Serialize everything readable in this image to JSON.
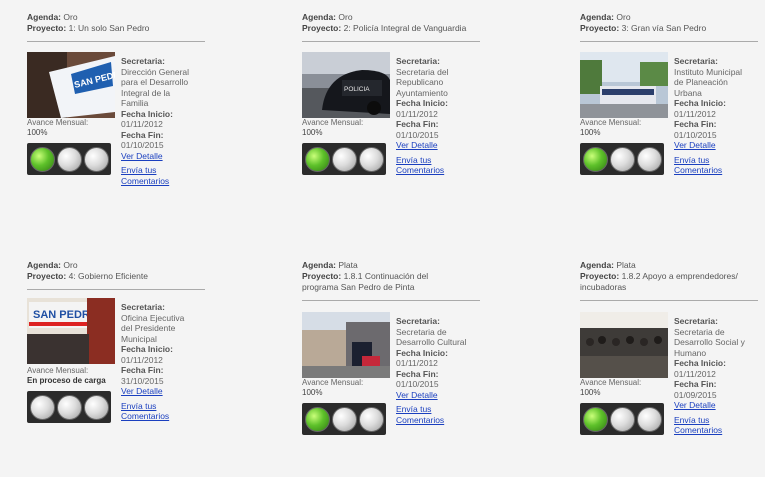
{
  "labels": {
    "agenda": "Agenda:",
    "proyecto": "Proyecto:",
    "secretaria": "Secretaria:",
    "fecha_inicio": "Fecha Inicio:",
    "fecha_fin": "Fecha Fin:",
    "avance": "Avance Mensual:",
    "ver_detalle": "Ver Detalle",
    "envia_1": "Envía tus",
    "envia_2": "Comentarios"
  },
  "cards": [
    {
      "agenda": "Oro",
      "proyecto_1": "1: Un solo San Pedro",
      "proyecto_2": "",
      "secretaria": [
        "Dirección General",
        "para el Desarrollo",
        "Integral de la",
        "Familia"
      ],
      "fecha_inicio": "01/11/2012",
      "fecha_fin": "01/10/2015",
      "avance": "100%",
      "light": "green"
    },
    {
      "agenda": "Oro",
      "proyecto_1": "2: Policía Integral de Vanguardia",
      "proyecto_2": "",
      "secretaria": [
        "Secretaria del",
        "Republicano",
        "Ayuntamiento"
      ],
      "fecha_inicio": "01/11/2012",
      "fecha_fin": "01/10/2015",
      "avance": "100%",
      "light": "green"
    },
    {
      "agenda": "Oro",
      "proyecto_1": "3: Gran vía San Pedro",
      "proyecto_2": "",
      "secretaria": [
        "Instituto Municipal",
        "de Planeación",
        "Urbana"
      ],
      "fecha_inicio": "01/11/2012",
      "fecha_fin": "01/10/2015",
      "avance": "100%",
      "light": "green"
    },
    {
      "agenda": "Oro",
      "proyecto_1": "4: Gobierno Eficiente",
      "proyecto_2": "",
      "secretaria": [
        "Oficina Ejecutiva",
        "del Presidente",
        "Municipal"
      ],
      "fecha_inicio": "01/11/2012",
      "fecha_fin": "31/10/2015",
      "avance": "En proceso de carga",
      "light": "none"
    },
    {
      "agenda": "Plata",
      "proyecto_1": "1.8.1 Continuación del",
      "proyecto_2": "programa San Pedro de Pinta",
      "secretaria": [
        "Secretaria de",
        "Desarrollo Cultural"
      ],
      "fecha_inicio": "01/11/2012",
      "fecha_fin": "01/10/2015",
      "avance": "100%",
      "light": "green"
    },
    {
      "agenda": "Plata",
      "proyecto_1": "1.8.2 Apoyo a emprendedores/",
      "proyecto_2": "incubadoras",
      "secretaria": [
        "Secretaria de",
        "Desarrollo Social y",
        "Humano"
      ],
      "fecha_inicio": "01/11/2012",
      "fecha_fin": "01/09/2015",
      "avance": "100%",
      "light": "green"
    }
  ],
  "photo_text": {
    "sanpedro": "SAN PEDRO",
    "policia": "POLICIA"
  },
  "colors": {
    "link": "#1a3fbf",
    "light_on": "#5ec12a",
    "light_off": "#d0d0d0",
    "panel": "#2b2b2b"
  }
}
